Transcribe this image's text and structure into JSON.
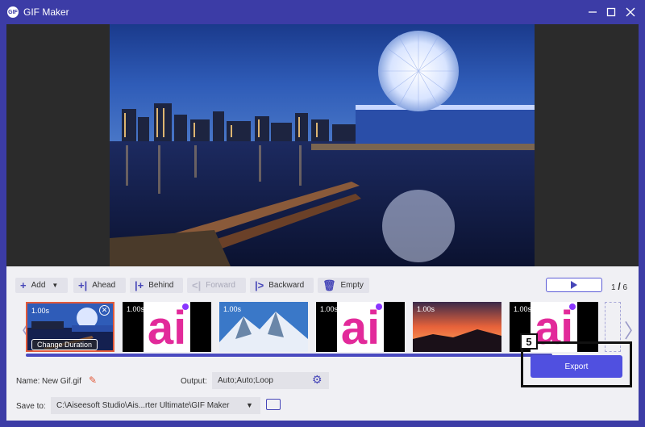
{
  "window": {
    "title": "GIF Maker",
    "logo_text": "GIF",
    "controls": [
      "minimize-icon",
      "maximize-icon",
      "close-icon"
    ]
  },
  "toolbar": {
    "add_label": "Add",
    "ahead_label": "Ahead",
    "behind_label": "Behind",
    "forward_label": "Forward",
    "backward_label": "Backward",
    "empty_label": "Empty",
    "counter_current": "1",
    "counter_sep": "/",
    "counter_total": "6"
  },
  "frames": [
    {
      "duration": "1.00s",
      "kind": "night-city",
      "selected": true,
      "overlay_label": "Change Duration"
    },
    {
      "duration": "1.00s",
      "kind": "ai-logo"
    },
    {
      "duration": "1.00s",
      "kind": "mountain"
    },
    {
      "duration": "1.00s",
      "kind": "ai-logo"
    },
    {
      "duration": "1.00s",
      "kind": "sunset"
    },
    {
      "duration": "1.00s",
      "kind": "ai-logo"
    }
  ],
  "bottom": {
    "name_label": "Name:",
    "name_value": "New Gif.gif",
    "output_label": "Output:",
    "output_value": "Auto;Auto;Loop",
    "save_label": "Save to:",
    "save_path": "C:\\Aiseesoft Studio\\Ais...rter Ultimate\\GIF Maker"
  },
  "export": {
    "badge": "5",
    "button_label": "Export"
  },
  "colors": {
    "accent": "#3c3ca6",
    "button": "#5050e0",
    "ai_pink": "#e22a9a",
    "ai_purple": "#8a35ff"
  }
}
